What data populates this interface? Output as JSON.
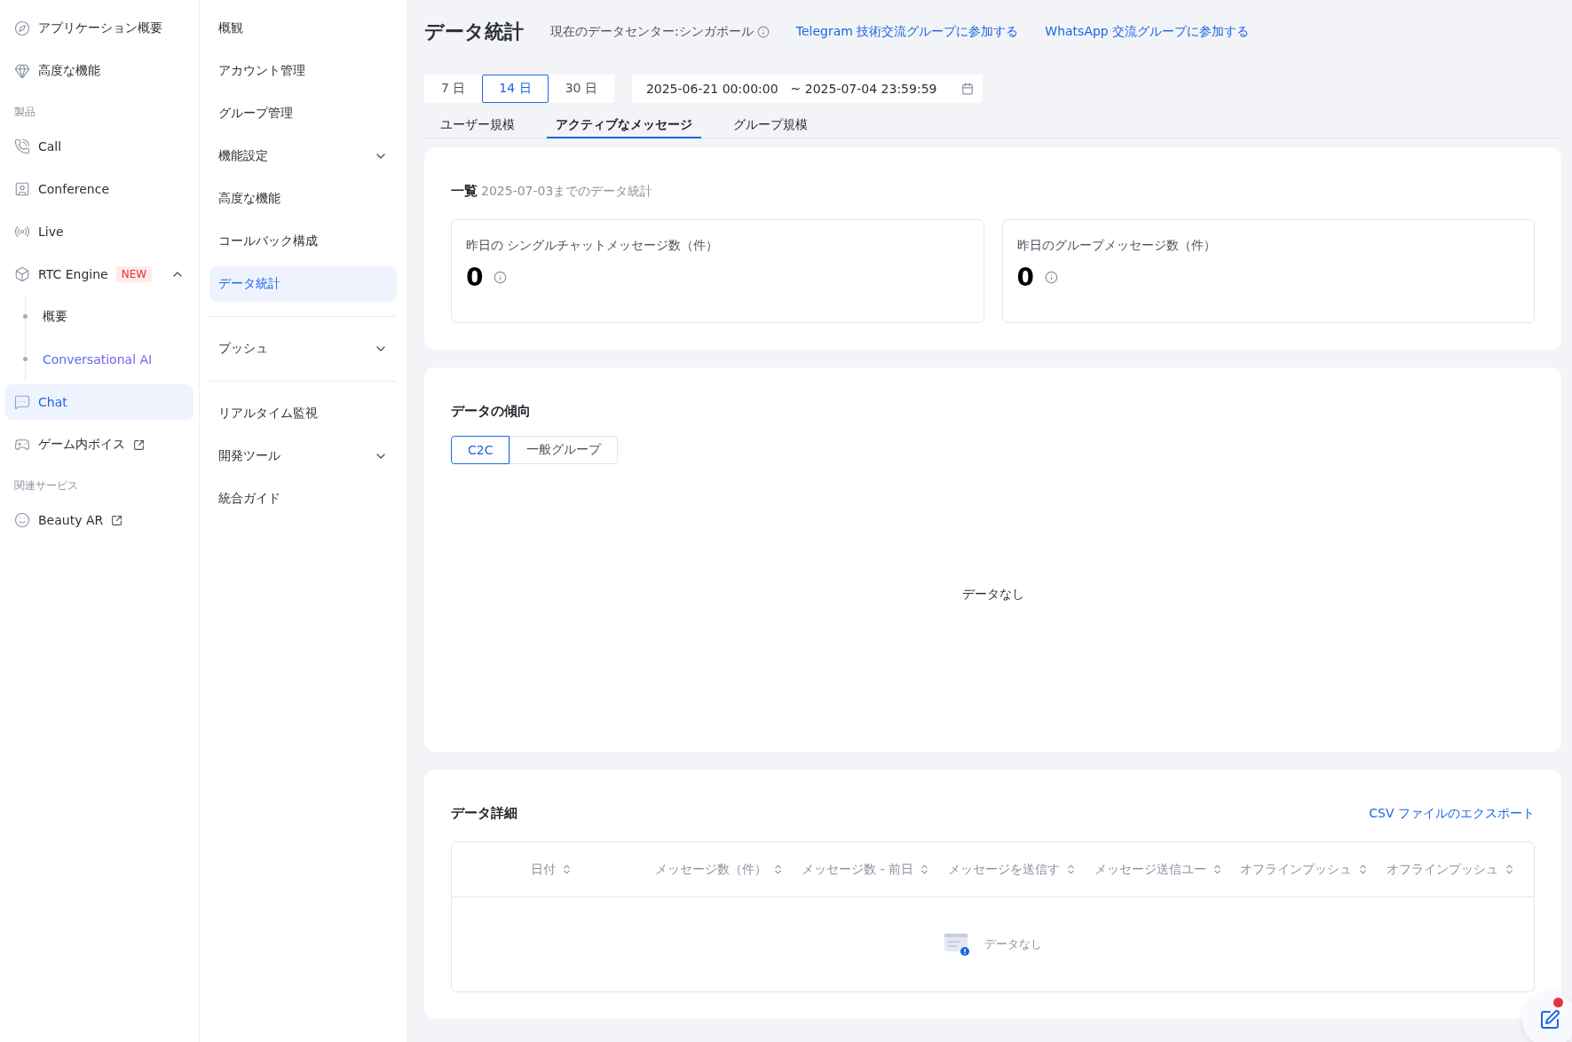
{
  "nav": [
    {
      "kind": "item",
      "label": "アプリケーション概要",
      "selected": false
    },
    {
      "kind": "item",
      "label": "高度な機能",
      "selected": false
    },
    {
      "kind": "section",
      "label": "製品"
    },
    {
      "kind": "item",
      "label": "Call",
      "selected": false
    },
    {
      "kind": "item",
      "label": "Conference",
      "selected": false
    },
    {
      "kind": "item",
      "label": "Live",
      "selected": false
    },
    {
      "kind": "item",
      "label": "RTC Engine",
      "selected": false,
      "badge": "NEW",
      "expanded": true,
      "children": [
        {
          "label": "概要",
          "kind": "plain"
        },
        {
          "label": "Conversational AI",
          "kind": "promo"
        }
      ]
    },
    {
      "kind": "item",
      "label": "Chat",
      "selected": true
    },
    {
      "kind": "item",
      "label": "ゲーム内ボイス",
      "selected": false,
      "external": true
    },
    {
      "kind": "section",
      "label": "関連サービス"
    },
    {
      "kind": "item",
      "label": "Beauty AR",
      "selected": false,
      "external": true
    }
  ],
  "subnav": [
    {
      "kind": "item",
      "label": "概観",
      "selected": false
    },
    {
      "kind": "item",
      "label": "アカウント管理",
      "selected": false
    },
    {
      "kind": "item",
      "label": "グループ管理",
      "selected": false
    },
    {
      "kind": "item",
      "label": "機能設定",
      "selected": false,
      "expanded": false
    },
    {
      "kind": "item",
      "label": "高度な機能",
      "selected": false
    },
    {
      "kind": "item",
      "label": "コールバック構成",
      "selected": false
    },
    {
      "kind": "item",
      "label": "データ統計",
      "selected": true
    },
    {
      "kind": "divider"
    },
    {
      "kind": "item",
      "label": "プッシュ",
      "selected": false,
      "expanded": false
    },
    {
      "kind": "divider"
    },
    {
      "kind": "item",
      "label": "リアルタイム監視",
      "selected": false
    },
    {
      "kind": "item",
      "label": "開発ツール",
      "selected": false,
      "expanded": false
    },
    {
      "kind": "item",
      "label": "統合ガイド",
      "selected": false
    }
  ],
  "header": {
    "title": "データ統計",
    "datacenter": "現在のデータセンター:シンガポール",
    "links": [
      "Telegram 技術交流グループに参加する",
      "WhatsApp 交流グループに参加する"
    ]
  },
  "periods": [
    {
      "label": "7 日",
      "selected": false
    },
    {
      "label": "14 日",
      "selected": true
    },
    {
      "label": "30 日",
      "selected": false
    }
  ],
  "date_range": {
    "start": "2025-06-21 00:00:00",
    "end": "~ 2025-07-04 23:59:59"
  },
  "tabs": [
    {
      "label": "ユーザー規模",
      "selected": false
    },
    {
      "label": "アクティブなメッセージ",
      "selected": true
    },
    {
      "label": "グループ規模",
      "selected": false
    }
  ],
  "overview": {
    "title": "一覧",
    "subtitle": "2025-07-03までのデータ統計",
    "stats": [
      {
        "label": "昨日の シングルチャットメッセージ数（件）",
        "value": "0"
      },
      {
        "label": "昨日のグループメッセージ数（件）",
        "value": "0"
      }
    ]
  },
  "trend": {
    "title": "データの傾向",
    "toggle": [
      {
        "label": "C2C",
        "selected": true
      },
      {
        "label": "一般グループ",
        "selected": false
      }
    ],
    "empty": "データなし"
  },
  "detail": {
    "title": "データ詳細",
    "export": "CSV ファイルのエクスポート",
    "columns": [
      "日付",
      "メッセージ数（件）",
      "メッセージ数 - 前日",
      "メッセージを送信す",
      "メッセージ送信ユー",
      "オフラインプッシュ",
      "オフラインプッシュ"
    ],
    "empty": "データなし"
  },
  "feedback": {
    "notification": true
  }
}
